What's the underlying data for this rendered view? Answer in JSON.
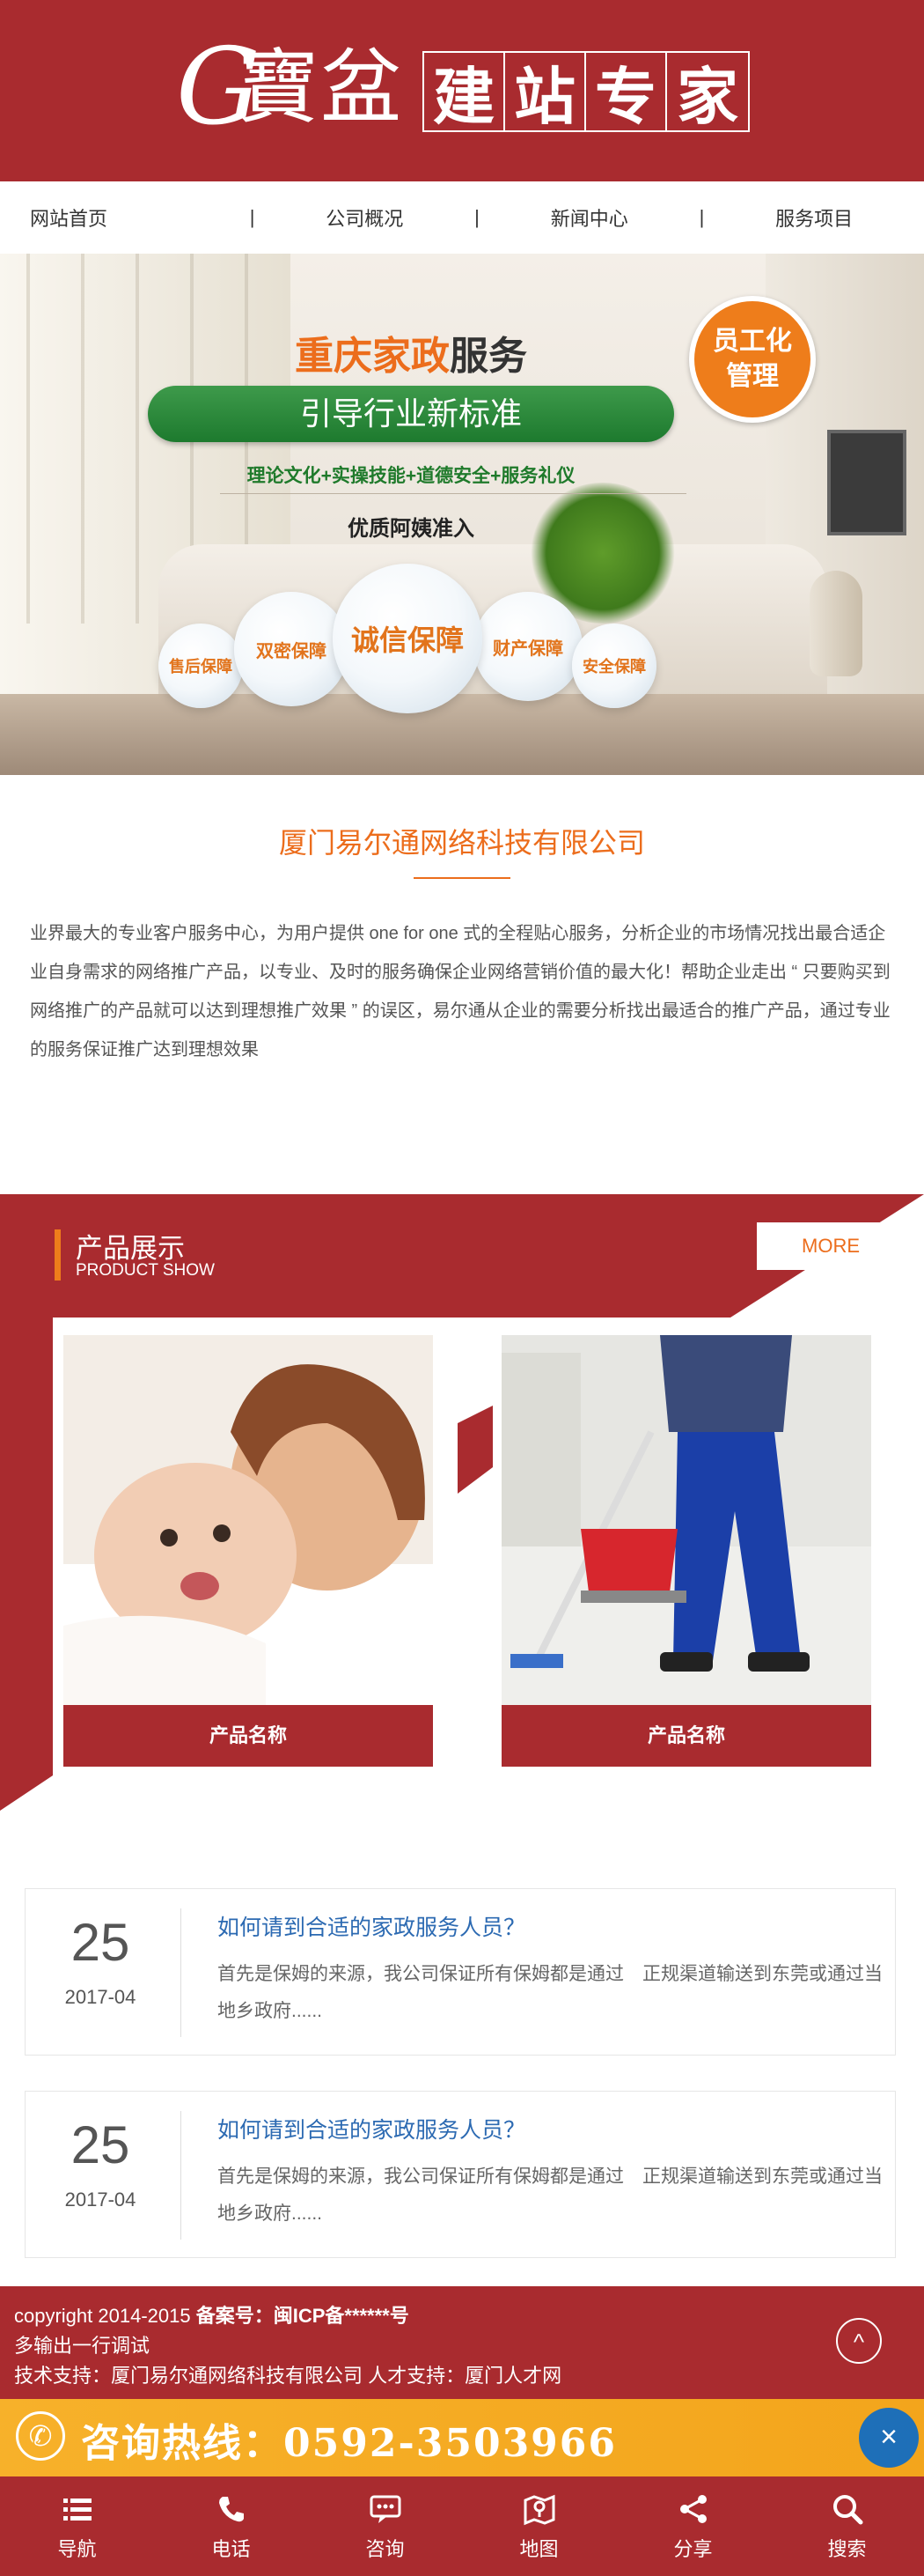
{
  "header": {
    "logo_letter": "G",
    "logo_script": "寶盆",
    "logo_chars": [
      "建",
      "站",
      "专",
      "家"
    ]
  },
  "topnav": {
    "items": [
      "网站首页",
      "公司概况",
      "新闻中心",
      "服务项目"
    ],
    "separator": "|"
  },
  "banner": {
    "title_orange": "重庆家政",
    "title_dark": "服务",
    "pill_text": "引导行业新标准",
    "subtitle": "理论文化+实操技能+道德安全+服务礼仪",
    "subtitle2": "优质阿姨准入",
    "badge_line1": "员工化",
    "badge_line2": "管理",
    "bubbles": [
      "售后保障",
      "双密保障",
      "诚信保障",
      "财产保障",
      "安全保障"
    ]
  },
  "about": {
    "title": "厦门易尔通网络科技有限公司",
    "text": "业界最大的专业客户服务中心，为用户提供 one for one 式的全程贴心服务，分析企业的市场情况找出最合适企业自身需求的网络推广产品，以专业、及时的服务确保企业网络营销价值的最大化！帮助企业走出 “ 只要购买到网络推广的产品就可以达到理想推广效果 ” 的误区，易尔通从企业的需要分析找出最适合的推广产品，通过专业的服务保证推广达到理想效果"
  },
  "products": {
    "title": "产品展示",
    "subtitle": "PRODUCT SHOW",
    "more": "MORE",
    "items": [
      {
        "caption": "产品名称"
      },
      {
        "caption": "产品名称"
      }
    ]
  },
  "news": [
    {
      "day": "25",
      "date": "2017-04",
      "title": "如何请到合适的家政服务人员？",
      "desc": "首先是保姆的来源，我公司保证所有保姆都是通过　正规渠道输送到东莞或通过当地乡政府......"
    },
    {
      "day": "25",
      "date": "2017-04",
      "title": "如何请到合适的家政服务人员？",
      "desc": "首先是保姆的来源，我公司保证所有保姆都是通过　正规渠道输送到东莞或通过当地乡政府......"
    }
  ],
  "footer": {
    "line1_prefix": "copyright 2014-2015 ",
    "line1_bold": "备案号：闽ICP备******号",
    "line2": "多输出一行调试",
    "line3": "技术支持：厦门易尔通网络科技有限公司 人才支持：厦门人才网",
    "top_btn": "^"
  },
  "hotline": {
    "icon": "✆",
    "text": "咨询热线：0592-3503966",
    "close": "×"
  },
  "bottomnav": {
    "items": [
      {
        "label": "导航",
        "icon": "menu-icon"
      },
      {
        "label": "电话",
        "icon": "phone-icon"
      },
      {
        "label": "咨询",
        "icon": "chat-icon"
      },
      {
        "label": "地图",
        "icon": "map-icon"
      },
      {
        "label": "分享",
        "icon": "share-icon"
      },
      {
        "label": "搜索",
        "icon": "search-icon"
      }
    ]
  },
  "colors": {
    "brand_red": "#a92b2f",
    "accent_orange": "#ec6d1c",
    "hotline_yellow": "#f7b12a",
    "link_blue": "#2c6ab2"
  }
}
